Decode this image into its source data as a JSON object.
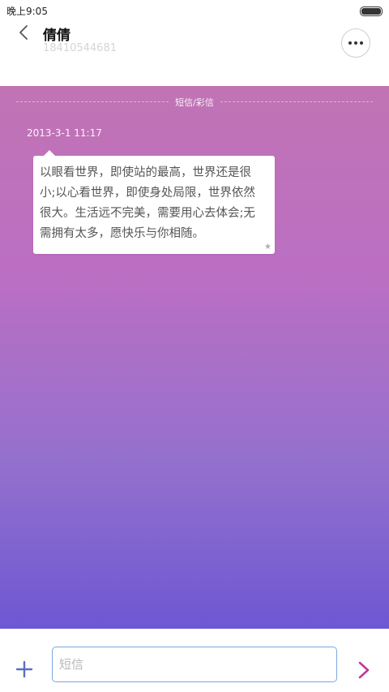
{
  "status_bar": {
    "time": "晚上9:05"
  },
  "header": {
    "contact_name": "倩倩",
    "contact_number": "18410544681",
    "back_icon": "chevron-left-icon",
    "more_icon": "more-dots-icon"
  },
  "conversation": {
    "divider_label": "短信/彩信",
    "messages": [
      {
        "timestamp": "2013-3-1 11:17",
        "text": "以眼看世界，即使站的最高，世界还是很小;以心看世界，即使身处局限，世界依然很大。生活远不完美，需要用心去体会;无需拥有太多，愿快乐与你相随。",
        "starred": true
      }
    ]
  },
  "input_bar": {
    "placeholder": "短信",
    "value": "",
    "add_icon": "plus-icon",
    "send_icon": "send-arrow-icon"
  },
  "colors": {
    "accent_blue": "#5a6fc0",
    "send_pink": "#c2389a",
    "input_border": "#7aa9e0"
  }
}
